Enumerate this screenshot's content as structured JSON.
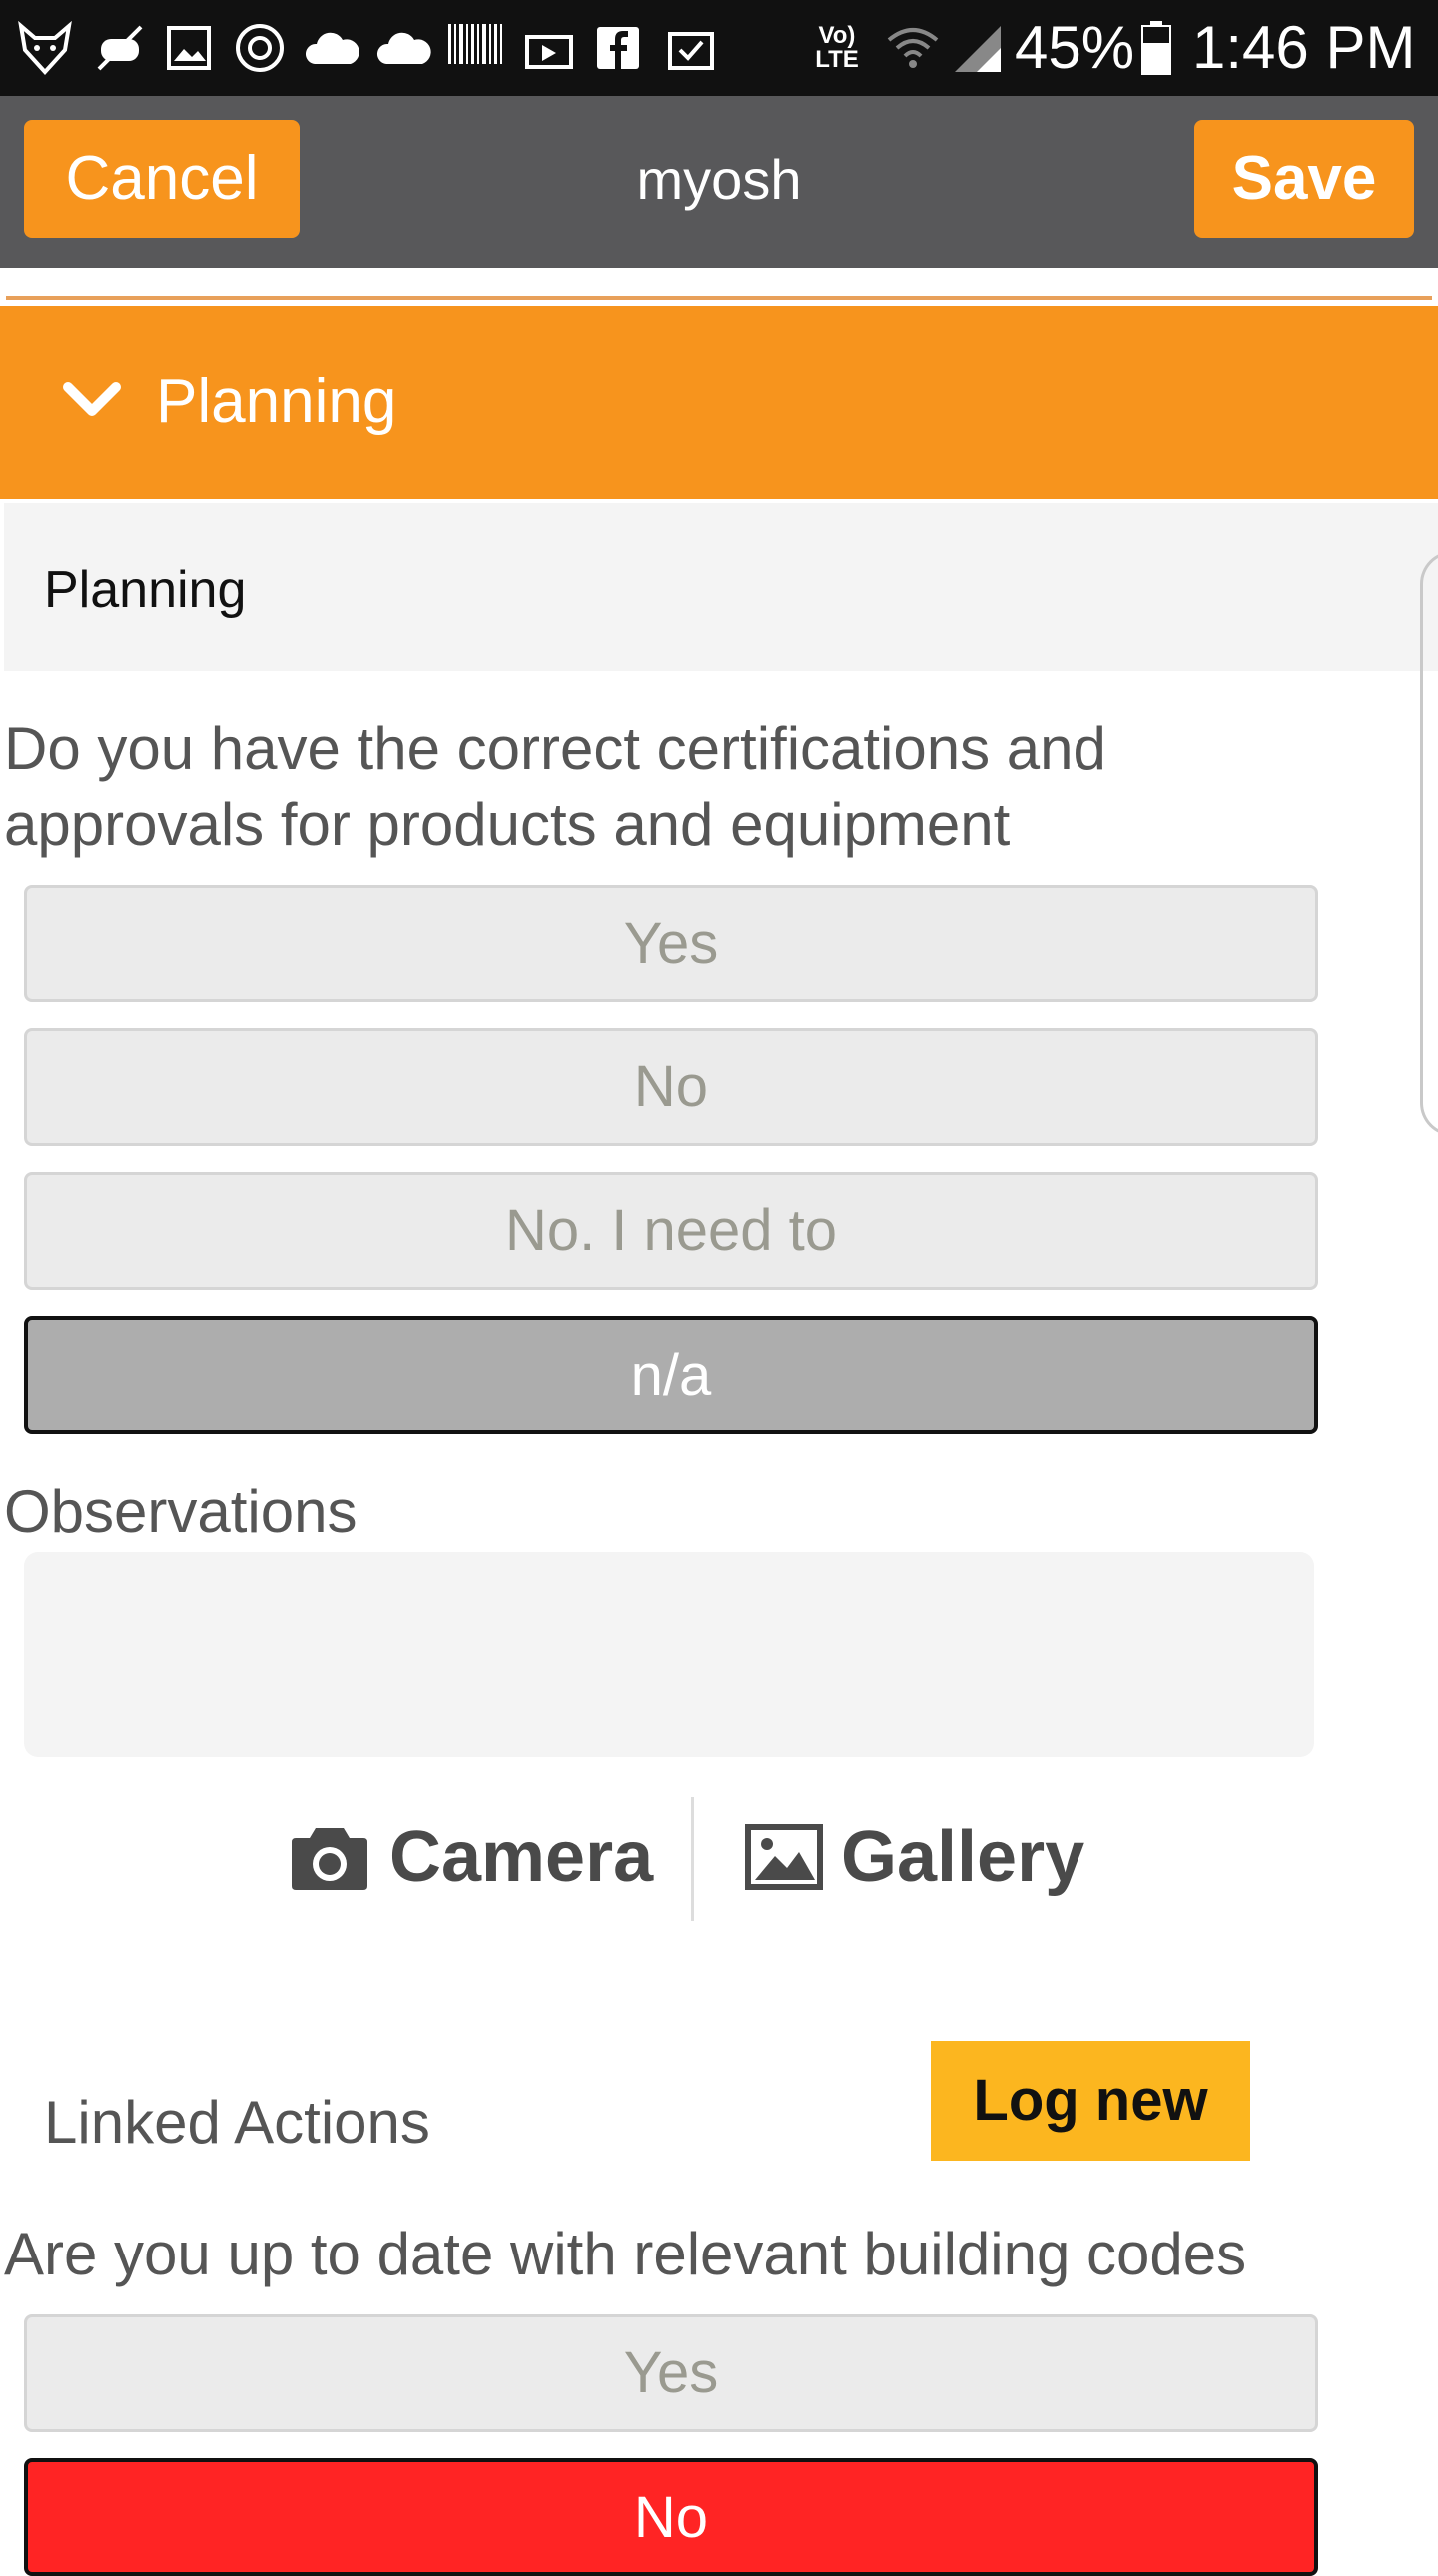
{
  "status_bar": {
    "volte": "Vo)",
    "lte": "LTE",
    "battery": "45%",
    "time": "1:46 PM",
    "icons": [
      "fox-icon",
      "gamepad-icon",
      "image-icon",
      "sync-icon",
      "cloud-icon",
      "cloud-icon",
      "barcode-icon",
      "upload-icon",
      "facebook-icon",
      "clipboard-check-icon",
      "wifi-icon",
      "signal-icon",
      "battery-icon"
    ]
  },
  "header": {
    "cancel_label": "Cancel",
    "title": "myosh",
    "save_label": "Save"
  },
  "section": {
    "title": "Planning",
    "subtitle": "Planning",
    "icon": "chevron-down-icon"
  },
  "question1": {
    "text": "Do you have the correct certifications and approvals for products and equipment",
    "options": [
      "Yes",
      "No",
      "No. I need to",
      "n/a"
    ],
    "selected": "n/a"
  },
  "observations": {
    "label": "Observations",
    "value": ""
  },
  "media": {
    "camera_label": "Camera",
    "gallery_label": "Gallery"
  },
  "linked_actions": {
    "label": "Linked Actions",
    "button_label": "Log new"
  },
  "question2": {
    "text": "Are you up to date with relevant building codes",
    "options": [
      "Yes",
      "No"
    ],
    "selected": "No"
  },
  "colors": {
    "accent_orange": "#f7941d",
    "header_grey": "#58585a",
    "log_new_yellow": "#fcb61f",
    "selected_red": "#ff2424",
    "selected_grey": "#adadad"
  }
}
